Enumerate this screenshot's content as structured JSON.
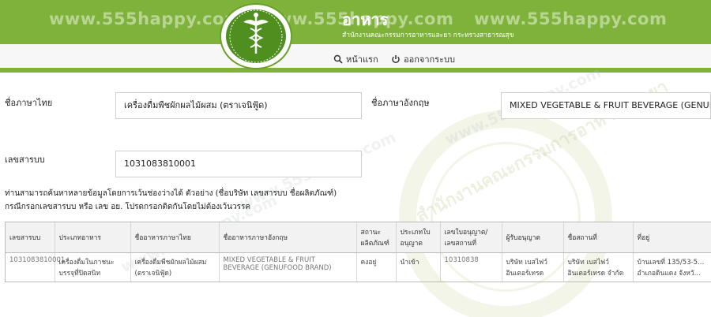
{
  "header": {
    "watermark": "www.555happy.com",
    "title": "อาหาร",
    "subtitle": "สำนักงานคณะกรรมการอาหารและยา กระทรวงสาธารณสุข",
    "bg_color": "#7fb23a"
  },
  "nav": {
    "home_label": "หน้าแรก",
    "logout_label": "ออกจากระบบ"
  },
  "form": {
    "thai_name_label": "ชื่อภาษาไทย",
    "thai_name_value": "เครื่องดื่มพืชผักผลไม้ผสม (ตราเจนิฟู้ด)",
    "eng_name_label": "ชื่อภาษาอังกฤษ",
    "eng_name_value": "MIXED VEGETABLE & FRUIT BEVERAGE (GENUFOOD BRAND)",
    "reg_no_label": "เลขสารบบ",
    "reg_no_value": "1031083810001"
  },
  "hint": {
    "line1": "ท่านสามารถค้นหาหลายข้อมูลโดยการเว้นช่องว่างได้ ตัวอย่าง (ชื่อบริษัท เลขสารบบ ชื่อผลิตภัณฑ์)",
    "line2": "กรณีกรอกเลขสารบบ หรือ เลข อย. โปรดกรอกติดกันโดยไม่ต้องเว้นวรรค"
  },
  "table": {
    "headers": [
      "เลขสารบบ",
      "ประเภทอาหาร",
      "ชื่ออาหารภาษาไทย",
      "ชื่ออาหารภาษาอังกฤษ",
      "สถานะผลิตภัณฑ์",
      "ประเภทใบอนุญาต",
      "เลขใบอนุญาต/เลขสถานที่",
      "ผู้รับอนุญาต",
      "ชื่อสถานที่",
      "ที่อยู่"
    ],
    "rows": [
      [
        "1031083810001",
        "เครื่องดื่มในภาชนะบรรจุที่ปิดสนิท",
        "เครื่องดื่มพืชผักผลไม้ผสม (ตราเจนิฟู้ด)",
        "MIXED VEGETABLE & FRUIT BEVERAGE (GENUFOOD BRAND)",
        "คงอยู่",
        "นำเข้า",
        "10310838",
        "บริษัท เบสไฟว์ อินเตอร์เทรด",
        "บริษัท เบสไฟว์ อินเตอร์เทรด จำกัด",
        "บ้านเลขที่ 135/53-5... อำเภอดินแดง จังหวั..."
      ]
    ]
  },
  "watermark": {
    "brand": "www.555happy.com",
    "ring_text": "สำนักงานคณะกรรมการอาหารและยา"
  }
}
